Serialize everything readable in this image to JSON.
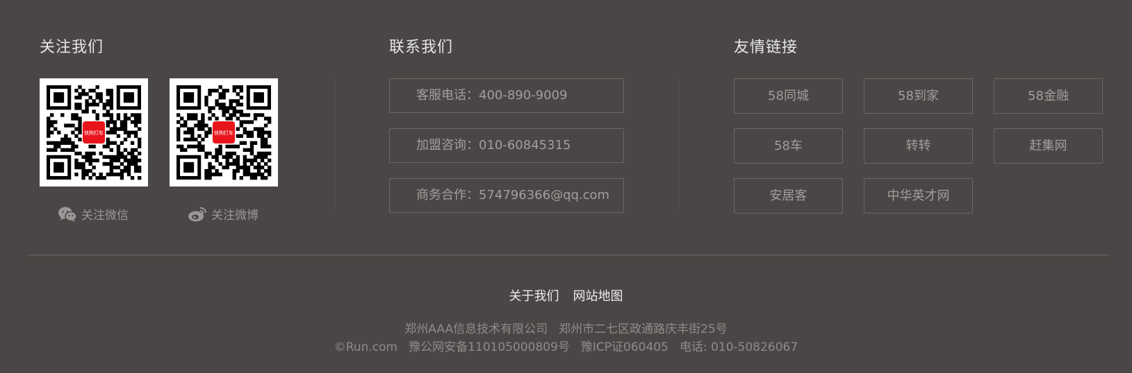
{
  "follow": {
    "title": "关注我们",
    "wechat_caption": "关注微信",
    "weibo_caption": "关注微博",
    "qr_logo_text": "快狗打车",
    "wechat_icon": "wechat-icon",
    "weibo_icon": "weibo-icon"
  },
  "contact": {
    "title": "联系我们",
    "items": [
      {
        "label": "客服电话：",
        "value": "400-890-9009"
      },
      {
        "label": "加盟咨询：",
        "value": "010-60845315"
      },
      {
        "label": "商务合作：",
        "value": "574796366@qq.com"
      }
    ]
  },
  "links": {
    "title": "友情链接",
    "items": [
      "58同城",
      "58到家",
      "58金融",
      "58车",
      "转转",
      "赶集网",
      "安居客",
      "中华英才网"
    ]
  },
  "footer": {
    "nav": [
      "关于我们",
      "网站地图"
    ],
    "company": "郑州AAA信息技术有限公司",
    "address": "郑州市二七区政通路庆丰街25号",
    "copyright": "©Run.com",
    "police_record": "豫公网安备110105000809号",
    "icp": "豫ICP证060405",
    "phone": "电话: 010-50826067"
  },
  "colors": {
    "background": "#4a4645",
    "border": "#6c6868",
    "qr_logo": "#e8141b"
  }
}
